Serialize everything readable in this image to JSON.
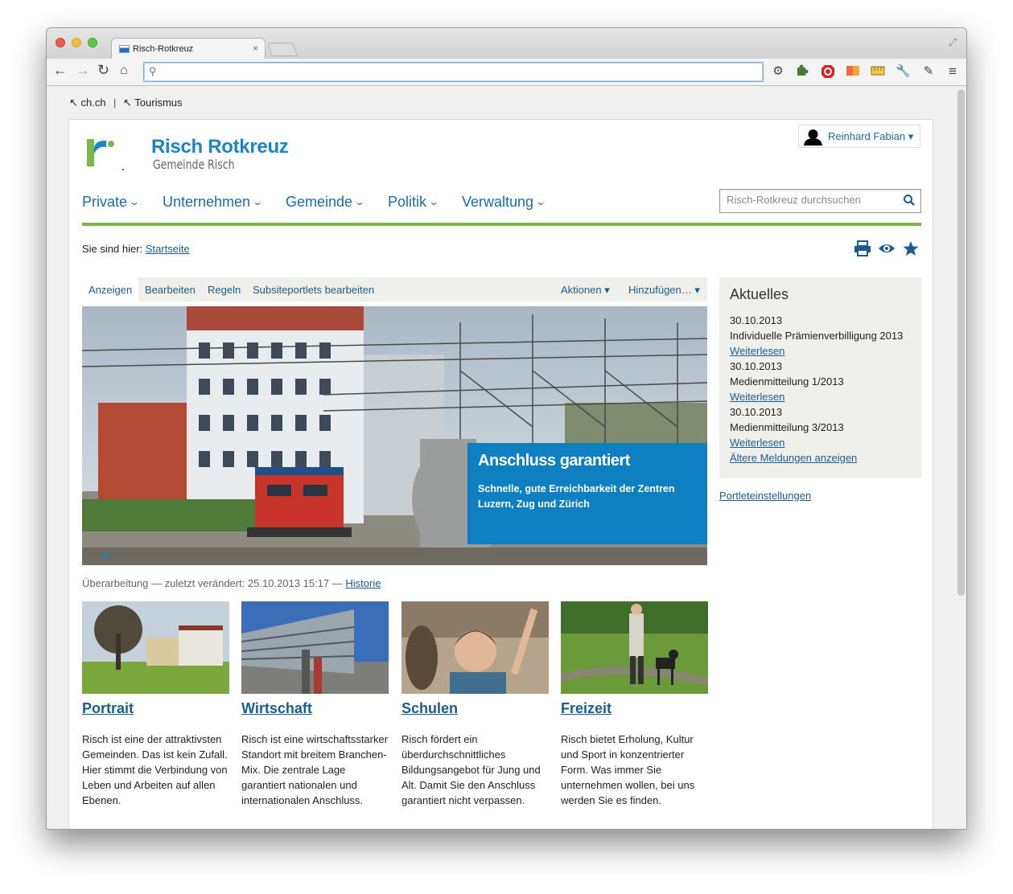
{
  "browser": {
    "tab_title": "Risch-Rotkreuz",
    "tab_close": "×",
    "address_value": "",
    "bookmarks": [
      {
        "label": "ch.ch",
        "arrow": "↖"
      },
      {
        "label": "Tourismus",
        "arrow": "↖"
      }
    ],
    "bookmark_separator": "|"
  },
  "site": {
    "title": "Risch Rotkreuz",
    "subtitle": "Gemeinde Risch",
    "brand_blue": "#1a86c6",
    "brand_green": "#7ab648",
    "user": {
      "name": "Reinhard Fabian",
      "caret": "▾"
    },
    "nav": [
      {
        "label": "Private"
      },
      {
        "label": "Unternehmen"
      },
      {
        "label": "Gemeinde"
      },
      {
        "label": "Politik"
      },
      {
        "label": "Verwaltung"
      }
    ],
    "nav_chevron": "⌄",
    "search_placeholder": "Risch-Rotkreuz durchsuchen",
    "breadcrumb": {
      "prefix": "Sie sind hier:",
      "link": "Startseite"
    }
  },
  "edit_tabs": {
    "items": [
      "Anzeigen",
      "Bearbeiten",
      "Regeln",
      "Subsiteportlets bearbeiten"
    ],
    "actions": "Aktionen ▾",
    "add": "Hinzufügen… ▾"
  },
  "hero": {
    "title": "Anschluss garantiert",
    "text": "Schnelle, gute Erreichbarkeit der Zentren Luzern, Zug und Zürich"
  },
  "meta": {
    "text": "Überarbeitung — zuletzt verändert: 25.10.2013 15:17 — ",
    "history_link": "Historie"
  },
  "teasers": [
    {
      "title": "Portrait",
      "text": "Risch ist eine der attraktivsten Gemeinden. Das ist kein Zufall. Hier stimmt die Verbindung von Leben und Arbeiten auf allen Ebenen."
    },
    {
      "title": "Wirtschaft",
      "text": "Risch ist eine wirtschaftsstarker Standort mit breitem Branchen-Mix. Die zentrale Lage garantiert nationalen und internationalen Anschluss."
    },
    {
      "title": "Schulen",
      "text": "Risch fördert ein überdurchschnittliches Bildungsangebot für Jung und Alt. Damit Sie den Anschluss garantiert nicht verpassen."
    },
    {
      "title": "Freizeit",
      "text": "Risch bietet Erholung, Kultur und Sport in konzentrierter Form. Was immer Sie unternehmen wollen, bei uns werden Sie es finden."
    }
  ],
  "news": {
    "heading": "Aktuelles",
    "items": [
      {
        "date": "30.10.2013",
        "title": "Individuelle Prämienverbilligung 2013",
        "link": "Weiterlesen"
      },
      {
        "date": "30.10.2013",
        "title": "Medienmitteilung 1/2013",
        "link": "Weiterlesen"
      },
      {
        "date": "30.10.2013",
        "title": "Medienmitteilung 3/2013",
        "link": "Weiterlesen"
      }
    ],
    "older": "Ältere Meldungen anzeigen"
  },
  "portlet_settings": "Portleteinstellungen"
}
